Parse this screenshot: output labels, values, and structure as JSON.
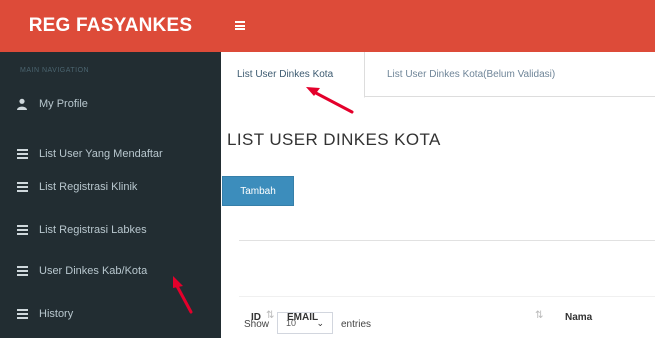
{
  "app": {
    "brand": "REG FASYANKES"
  },
  "sidebar": {
    "header": "MAIN NAVIGATION",
    "items": [
      {
        "label": "My Profile",
        "icon": "user-icon"
      },
      {
        "label": "List User Yang Mendaftar",
        "icon": "list-icon"
      },
      {
        "label": "List Registrasi Klinik",
        "icon": "list-icon"
      },
      {
        "label": "List Registrasi Labkes",
        "icon": "list-icon"
      },
      {
        "label": "User Dinkes Kab/Kota",
        "icon": "list-icon"
      },
      {
        "label": "History",
        "icon": "list-icon"
      }
    ]
  },
  "tabs": [
    {
      "label": "List User Dinkes Kota"
    },
    {
      "label": "List User Dinkes Kota(Belum Validasi)"
    }
  ],
  "main": {
    "title": "LIST USER DINKES KOTA",
    "add_button": "Tambah",
    "show_label": "Show",
    "entries_value": "10",
    "entries_label": "entries"
  },
  "table": {
    "columns": [
      "ID",
      "EMAIL",
      "Nama"
    ]
  },
  "colors": {
    "header_red": "#dd4b39",
    "sidebar_dark": "#222d32",
    "button_blue": "#3c8dbc",
    "annotation_red": "#e4002b"
  }
}
